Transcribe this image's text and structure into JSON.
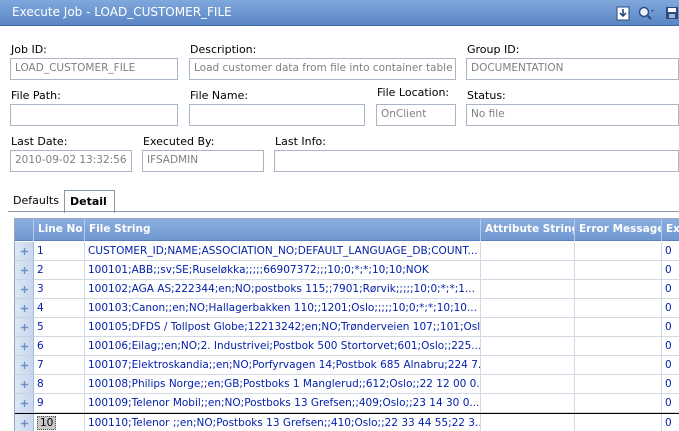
{
  "window": {
    "title": "Execute Job - LOAD_CUSTOMER_FILE"
  },
  "form": {
    "job_id": {
      "label": "Job ID:",
      "value": "LOAD_CUSTOMER_FILE"
    },
    "description": {
      "label": "Description:",
      "value": "Load customer data from file into container table"
    },
    "group_id": {
      "label": "Group ID:",
      "value": "DOCUMENTATION"
    },
    "file_path": {
      "label": "File Path:",
      "value": ""
    },
    "file_name": {
      "label": "File Name:",
      "value": ""
    },
    "file_location": {
      "label": "File Location:",
      "value": "OnClient"
    },
    "status": {
      "label": "Status:",
      "value": "No file"
    },
    "last_date": {
      "label": "Last Date:",
      "value": "2010-09-02 13:32:56"
    },
    "executed_by": {
      "label": "Executed By:",
      "value": "IFSADMIN"
    },
    "last_info": {
      "label": "Last Info:",
      "value": ""
    }
  },
  "tabs": [
    {
      "label": "Defaults",
      "active": false
    },
    {
      "label": "Detail",
      "active": true
    }
  ],
  "grid": {
    "columns": [
      "Line No",
      "File String",
      "Attribute String",
      "Error Message",
      "Ex"
    ],
    "rows": [
      {
        "line_no": "1",
        "file_string": "CUSTOMER_ID;NAME;ASSOCIATION_NO;DEFAULT_LANGUAGE_DB;COUNT...",
        "attribute_string": "",
        "error_message": "",
        "ex": "0"
      },
      {
        "line_no": "2",
        "file_string": "100101;ABB;;sv;SE;Ruseløkka;;;;;66907372;;;10;0;*;*;10;10;NOK",
        "attribute_string": "",
        "error_message": "",
        "ex": "0"
      },
      {
        "line_no": "3",
        "file_string": "100102;AGA AS;222344;en;NO;postboks 115;;7901;Rørvik;;;;;10;0;*;*;1...",
        "attribute_string": "",
        "error_message": "",
        "ex": "0"
      },
      {
        "line_no": "4",
        "file_string": "100103;Canon;;en;NO;Hallagerbakken 110;;1201;Oslo;;;;;10;0;*;*;10;10...",
        "attribute_string": "",
        "error_message": "",
        "ex": "0"
      },
      {
        "line_no": "5",
        "file_string": "100105;DFDS / Tollpost Globe;12213242;en;NO;Trønderveien 107;;101;Osl...",
        "attribute_string": "",
        "error_message": "",
        "ex": "0"
      },
      {
        "line_no": "6",
        "file_string": "100106;Eilag;;en;NO;2. Industrivei;Postbok 500 Stortorvet;601;Oslo;;225...",
        "attribute_string": "",
        "error_message": "",
        "ex": "0"
      },
      {
        "line_no": "7",
        "file_string": "100107;Elektroskandia;;en;NO;Porfyrvagen 14;Postbok 685 Alnabru;224 7...",
        "attribute_string": "",
        "error_message": "",
        "ex": "0"
      },
      {
        "line_no": "8",
        "file_string": "100108;Philips Norge;;en;GB;Postboks 1 Manglerud;;612;Oslo;;22 12 00 0...",
        "attribute_string": "",
        "error_message": "",
        "ex": "0"
      },
      {
        "line_no": "9",
        "file_string": "100109;Telenor Mobil;;en;NO;Postboks 13 Grefsen;;409;Oslo;;23 14 30 0...",
        "attribute_string": "",
        "error_message": "",
        "ex": "0"
      },
      {
        "line_no": "10",
        "file_string": "100110;Telenor ;;en;NO;Postboks 13 Grefsen;;410;Oslo;;22 33 44 55;22 3...",
        "attribute_string": "",
        "error_message": "",
        "ex": "0"
      }
    ],
    "current_row": 9
  },
  "icons": {
    "save": "save-icon",
    "search": "search-icon",
    "download": "download-icon",
    "row_selector": "row-selector-icon"
  },
  "colors": {
    "titlebar": "#6f97d1",
    "grid_text": "#001eaa",
    "field_text": "#808080"
  }
}
